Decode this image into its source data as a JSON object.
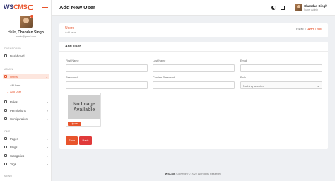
{
  "brand": {
    "logo_text_1": "WS",
    "logo_text_2": "CMS"
  },
  "sidebar": {
    "user": {
      "greeting": "Hello,",
      "name": "Chandan Singh",
      "email": "admin@gmail.com"
    },
    "sections": {
      "dashboard": "DASHBOARD",
      "admin": "ADMIN",
      "cms": "CMS",
      "more": "MENU"
    },
    "items": {
      "dashboard": "Dashboard",
      "users": "Users",
      "all_users": "All Users",
      "add_user": "Add User",
      "roles": "Roles",
      "permissions": "Permissions",
      "configuration": "Configuration",
      "pages": "Pages",
      "blogs": "Blogs",
      "categories": "Categories",
      "tags": "Tags"
    }
  },
  "topbar": {
    "title": "Add New User",
    "user_name": "Chandan Singh",
    "user_role": "Super Admin"
  },
  "breadcrumb": {
    "title": "Users",
    "subtitle": "Add user",
    "parent": "Users",
    "separator": "/",
    "current": "Add User"
  },
  "form": {
    "heading": "Add User",
    "fields": {
      "first_name": {
        "label": "First Name",
        "value": ""
      },
      "last_name": {
        "label": "Last Name",
        "value": ""
      },
      "email": {
        "label": "Email",
        "value": ""
      },
      "password": {
        "label": "Password",
        "value": ""
      },
      "confirm_password": {
        "label": "Confirm Password",
        "value": ""
      },
      "role": {
        "label": "Role",
        "selected": "Nothing selected"
      }
    },
    "image": {
      "placeholder_line1": "No Image",
      "placeholder_line2": "Available",
      "upload_label": "Upload"
    },
    "save_label": "Save",
    "back_label": "Back"
  },
  "footer": {
    "brand": "WSCMS",
    "text": "Copyright © 2022 All Rights Reserved"
  },
  "colors": {
    "accent": "#e8542c",
    "danger": "#e03a3a",
    "background": "#eef0f3"
  }
}
